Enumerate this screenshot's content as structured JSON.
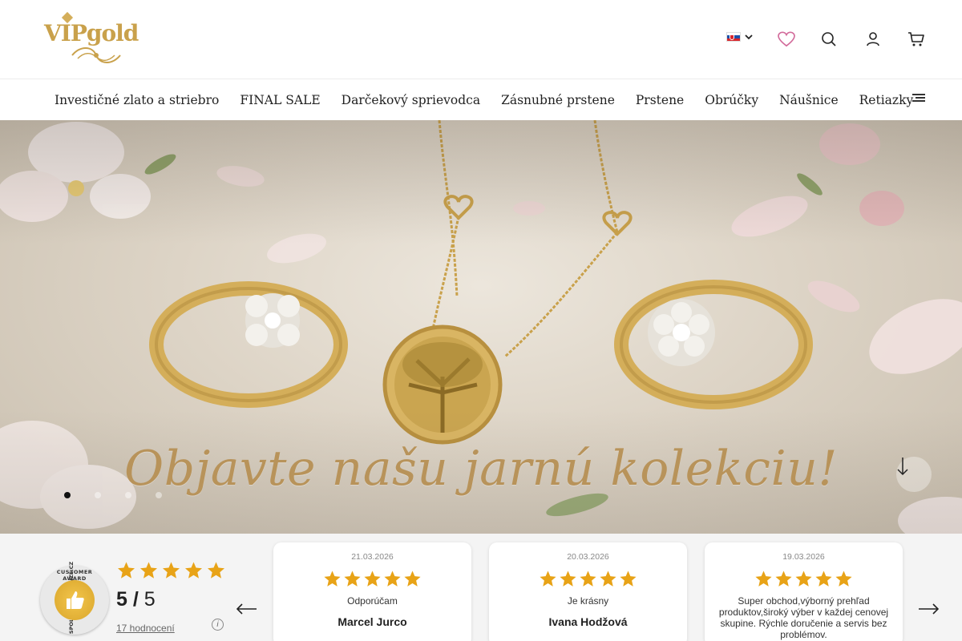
{
  "brand": {
    "logo_text": "VIPgold",
    "accent": "#c9a14b"
  },
  "header": {
    "language": {
      "flag": "slovakia-flag",
      "selected": "SK"
    },
    "icons": [
      "heart-icon",
      "search-icon",
      "user-icon",
      "cart-icon"
    ]
  },
  "nav": {
    "items": [
      {
        "label": "Investičné zlato a striebro"
      },
      {
        "label": "FINAL SALE"
      },
      {
        "label": "Darčekový sprievodca"
      },
      {
        "label": "Zásnubné prstene"
      },
      {
        "label": "Prstene"
      },
      {
        "label": "Obrúčky"
      },
      {
        "label": "Náušnice"
      },
      {
        "label": "Retiazky"
      }
    ],
    "menu_icon": "hamburger-icon"
  },
  "hero": {
    "title": "Objavte našu jarnú kolekciu!",
    "slides": 4,
    "active_slide": 1,
    "title_color": "#b8935a"
  },
  "reviews": {
    "badge": {
      "top_text": "CUSTOMER AWARD",
      "side_text": "SPOLEHLIVERECENZE.CZ"
    },
    "rating": {
      "value": "5",
      "separator": "/",
      "max": "5",
      "stars": 5
    },
    "count_text": "17 hodnocení",
    "info_icon": "i",
    "cards": [
      {
        "date": "21.03.2026",
        "stars": 5,
        "text": "Odporúčam",
        "name": "Marcel Jurco"
      },
      {
        "date": "20.03.2026",
        "stars": 5,
        "text": "Je krásny",
        "name": "Ivana Hodžová"
      },
      {
        "date": "19.03.2026",
        "stars": 5,
        "text": "Super obchod,výborný prehľad produktov,široký výber v každej cenovej skupine. Rýchle doručenie a servis bez problémov.",
        "name": ""
      }
    ],
    "star_color": "#e8a317"
  }
}
